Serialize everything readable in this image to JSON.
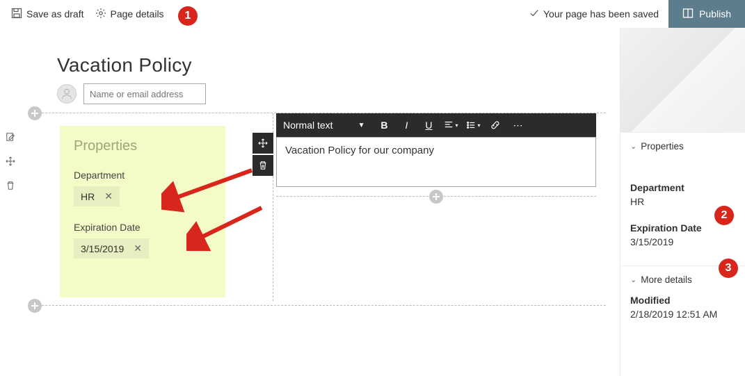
{
  "topbar": {
    "save_draft": "Save as draft",
    "page_details": "Page details",
    "saved_msg": "Your page has been saved",
    "publish": "Publish"
  },
  "page": {
    "title": "Vacation Policy",
    "name_placeholder": "Name or email address"
  },
  "properties_card": {
    "heading": "Properties",
    "department_label": "Department",
    "department_value": "HR",
    "expiration_label": "Expiration Date",
    "expiration_value": "3/15/2019"
  },
  "editor": {
    "style_label": "Normal text",
    "text": "Vacation Policy for our company"
  },
  "right_panel": {
    "properties_head": "Properties",
    "department_label": "Department",
    "department_value": "HR",
    "expiration_label": "Expiration Date",
    "expiration_value": "3/15/2019",
    "more_details_head": "More details",
    "modified_label": "Modified",
    "modified_value": "2/18/2019 12:51 AM"
  },
  "annotations": {
    "b1": "1",
    "b2": "2",
    "b3": "3"
  }
}
